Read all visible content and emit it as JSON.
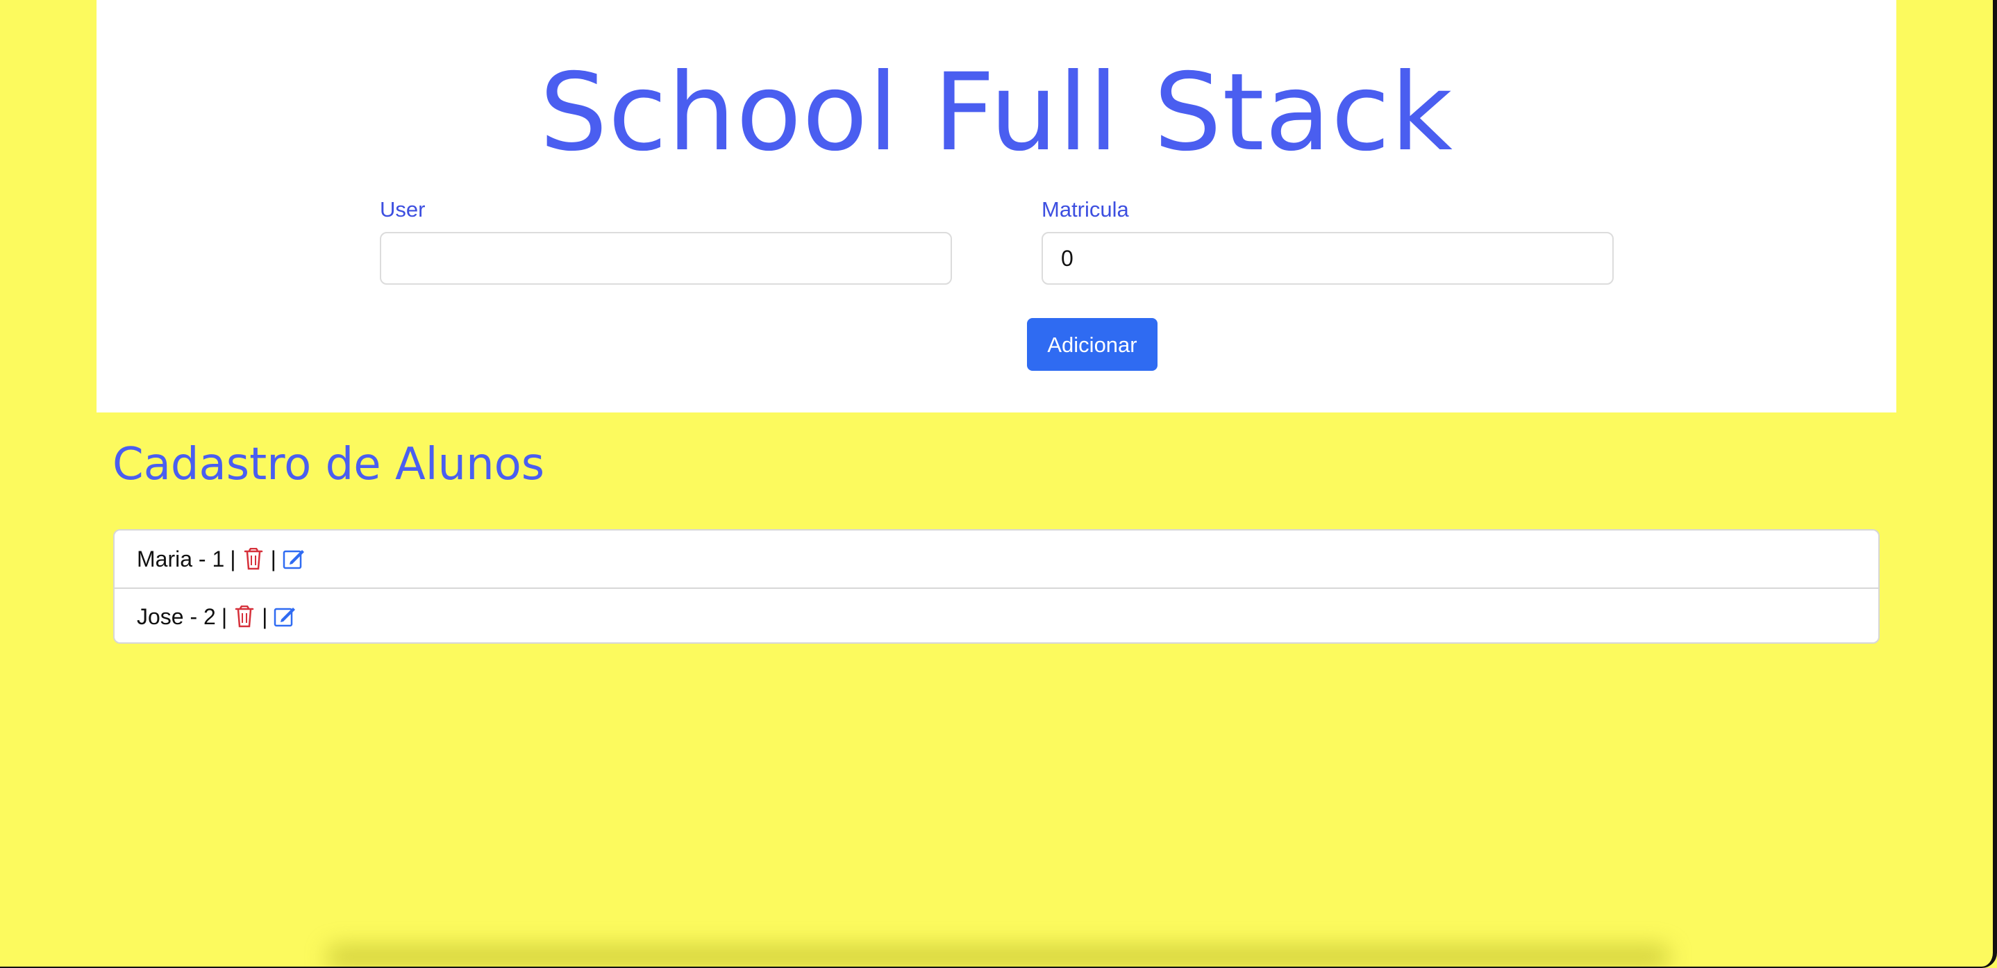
{
  "page": {
    "background_color": "#fcfa5e",
    "accent_color": "#4a5ef0",
    "button_color": "#2f6bf2",
    "delete_icon_color": "#d6303a",
    "edit_icon_color": "#2f6bf2"
  },
  "header": {
    "title": "School Full Stack",
    "user_field": {
      "label": "User",
      "value": "",
      "placeholder": ""
    },
    "matricula_field": {
      "label": "Matricula",
      "value": "0",
      "placeholder": ""
    },
    "add_button_label": "Adicionar"
  },
  "students_section": {
    "title": "Cadastro de Alunos",
    "items": [
      {
        "text": "Maria - 1",
        "separator_1": "|",
        "delete_icon": "trash-icon",
        "separator_2": "|",
        "edit_icon": "edit-icon"
      },
      {
        "text": "Jose - 2",
        "separator_1": "|",
        "delete_icon": "trash-icon",
        "separator_2": "|",
        "edit_icon": "edit-icon"
      }
    ]
  }
}
